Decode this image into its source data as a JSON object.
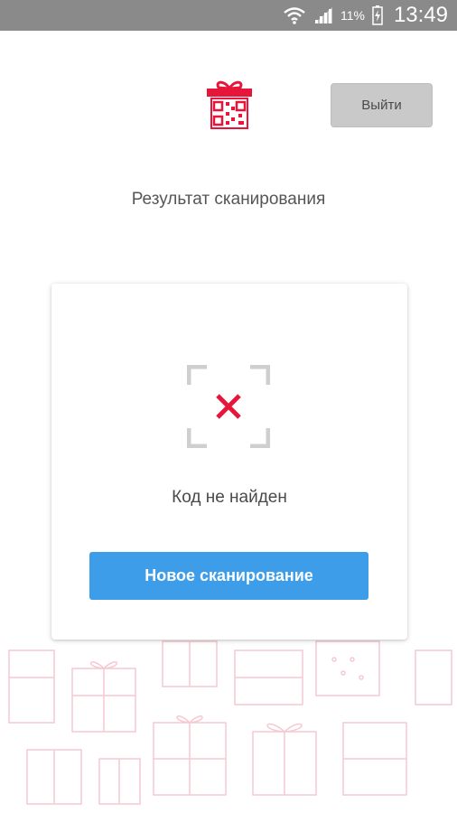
{
  "status_bar": {
    "battery_percent": "11%",
    "time": "13:49",
    "icons": [
      "wifi-icon",
      "signal-icon",
      "battery-icon"
    ]
  },
  "header": {
    "logo": "gift-qr-logo",
    "logout_label": "Выйти"
  },
  "page": {
    "title": "Результат сканирования"
  },
  "result": {
    "status_icon": "scan-frame-cross-icon",
    "message": "Код не найден",
    "new_scan_label": "Новое сканирование"
  },
  "colors": {
    "accent_red": "#e8153a",
    "primary_blue": "#3d9de8",
    "status_bar": "#8a8a8a",
    "logout_bg": "#c9c9c9",
    "pattern_pink": "#f6c9d2"
  }
}
